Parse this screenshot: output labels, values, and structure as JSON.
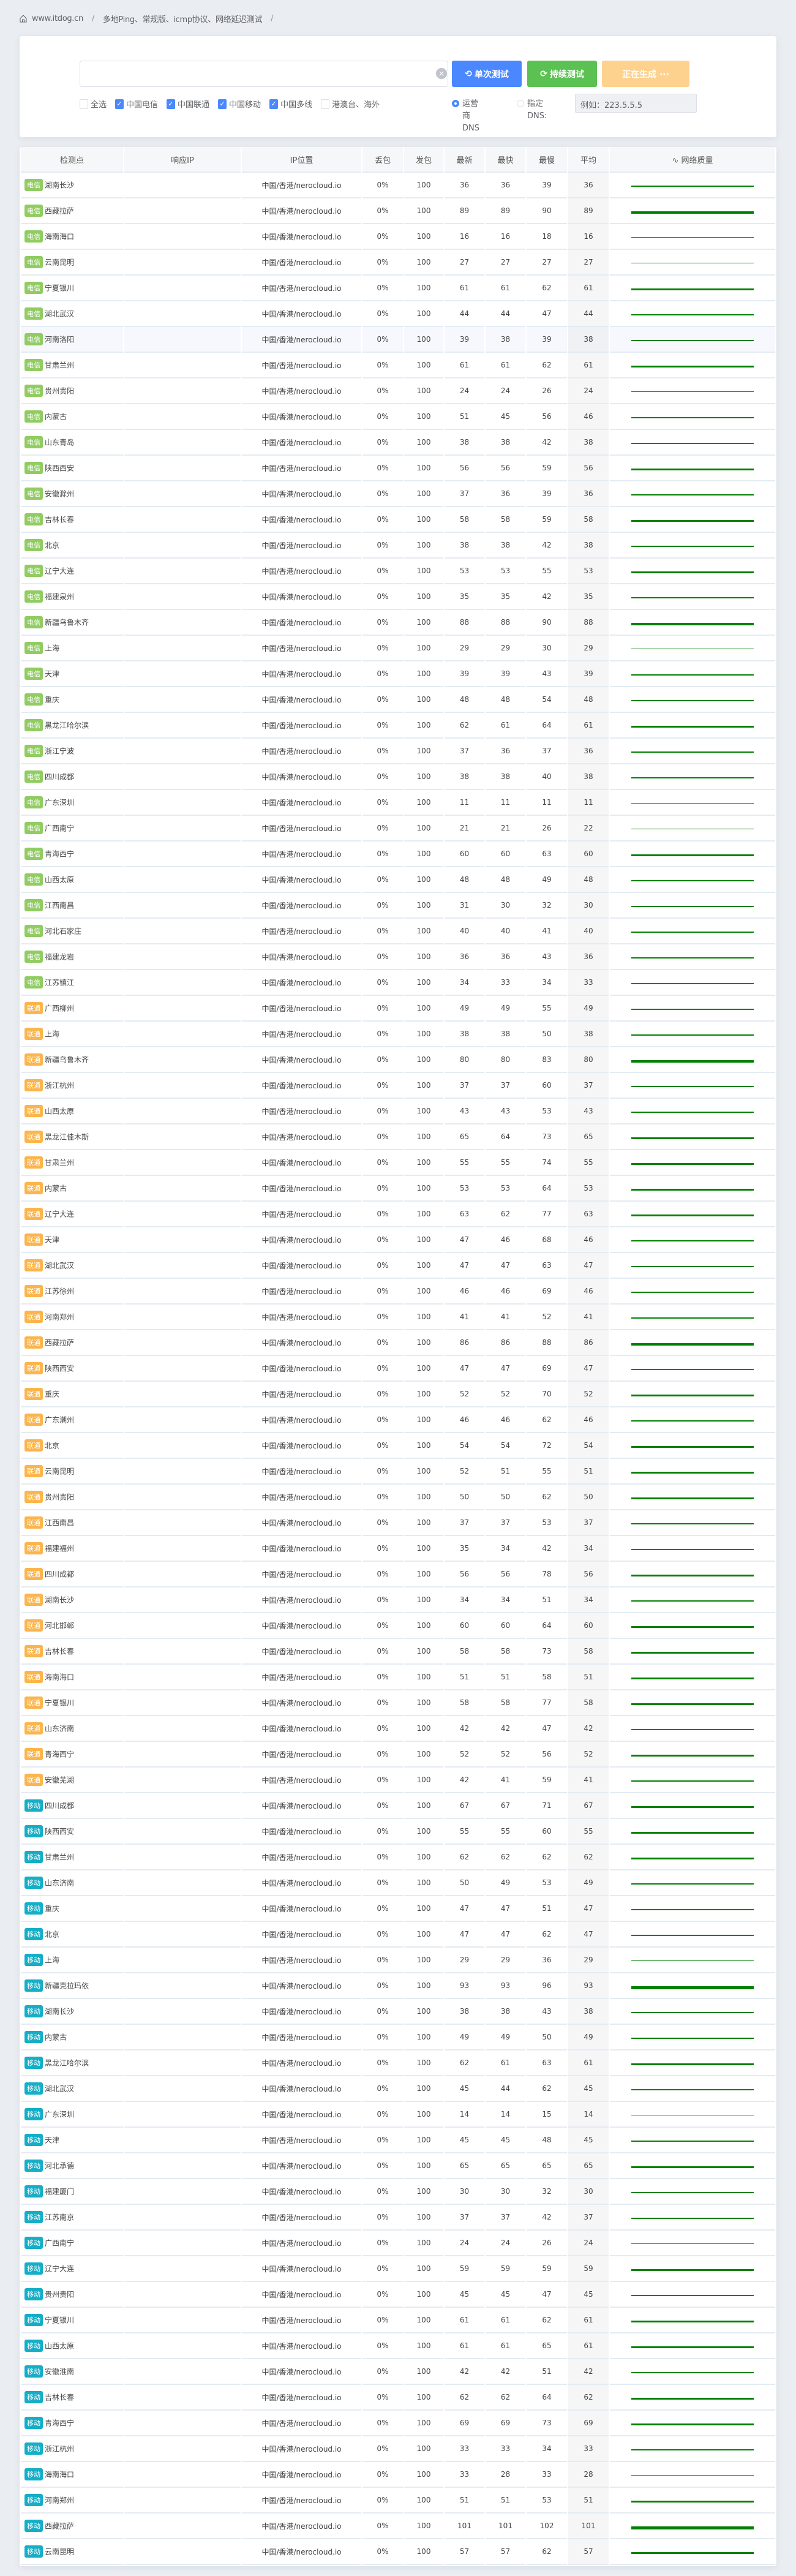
{
  "breadcrumb": {
    "site": "www.itdog.cn",
    "page": "多地Ping、常规版、icmp协议、网络延迟测试",
    "separator": "/"
  },
  "search": {
    "host_value": "",
    "single_test_label": "单次测试",
    "continuous_test_label": "持续测试",
    "generating_label": "正在生成 ···",
    "checkboxes": [
      {
        "label": "全选",
        "checked": false
      },
      {
        "label": "中国电信",
        "checked": true
      },
      {
        "label": "中国联通",
        "checked": true
      },
      {
        "label": "中国移动",
        "checked": true
      },
      {
        "label": "中国多线",
        "checked": true
      },
      {
        "label": "港澳台、海外",
        "checked": false
      }
    ],
    "dns_options": [
      {
        "label": "运营商DNS",
        "selected": true
      },
      {
        "label": "指定DNS:",
        "selected": false
      }
    ],
    "dns_placeholder": "例如：223.5.5.5"
  },
  "table": {
    "headers": [
      "检测点",
      "响应IP",
      "IP位置",
      "丢包",
      "发包",
      "最新",
      "最快",
      "最慢",
      "平均",
      "网络质量"
    ],
    "quality_icon": "pulse-icon",
    "isp_colors": {
      "电信": "#91cc63",
      "联通": "#fbb54c",
      "移动": "#14aec7"
    },
    "quality_color": "#008000",
    "ip_location": "中国/香港/nerocloud.io",
    "loss": "0%",
    "sent": "100",
    "rows": [
      [
        "电信",
        "湖南长沙",
        36,
        36,
        39,
        36
      ],
      [
        "电信",
        "西藏拉萨",
        89,
        89,
        90,
        89
      ],
      [
        "电信",
        "海南海口",
        16,
        16,
        18,
        16
      ],
      [
        "电信",
        "云南昆明",
        27,
        27,
        27,
        27
      ],
      [
        "电信",
        "宁夏银川",
        61,
        61,
        62,
        61
      ],
      [
        "电信",
        "湖北武汉",
        44,
        44,
        47,
        44
      ],
      [
        "电信",
        "河南洛阳",
        39,
        38,
        39,
        38
      ],
      [
        "电信",
        "甘肃兰州",
        61,
        61,
        62,
        61
      ],
      [
        "电信",
        "贵州贵阳",
        24,
        24,
        26,
        24
      ],
      [
        "电信",
        "内蒙古",
        51,
        45,
        56,
        46
      ],
      [
        "电信",
        "山东青岛",
        38,
        38,
        42,
        38
      ],
      [
        "电信",
        "陕西西安",
        56,
        56,
        59,
        56
      ],
      [
        "电信",
        "安徽滁州",
        37,
        36,
        39,
        36
      ],
      [
        "电信",
        "吉林长春",
        58,
        58,
        59,
        58
      ],
      [
        "电信",
        "北京",
        38,
        38,
        42,
        38
      ],
      [
        "电信",
        "辽宁大连",
        53,
        53,
        55,
        53
      ],
      [
        "电信",
        "福建泉州",
        35,
        35,
        42,
        35
      ],
      [
        "电信",
        "新疆乌鲁木齐",
        88,
        88,
        90,
        88
      ],
      [
        "电信",
        "上海",
        29,
        29,
        30,
        29
      ],
      [
        "电信",
        "天津",
        39,
        39,
        43,
        39
      ],
      [
        "电信",
        "重庆",
        48,
        48,
        54,
        48
      ],
      [
        "电信",
        "黑龙江哈尔滨",
        62,
        61,
        64,
        61
      ],
      [
        "电信",
        "浙江宁波",
        37,
        36,
        37,
        36
      ],
      [
        "电信",
        "四川成都",
        38,
        38,
        40,
        38
      ],
      [
        "电信",
        "广东深圳",
        11,
        11,
        11,
        11
      ],
      [
        "电信",
        "广西南宁",
        21,
        21,
        26,
        22
      ],
      [
        "电信",
        "青海西宁",
        60,
        60,
        63,
        60
      ],
      [
        "电信",
        "山西太原",
        48,
        48,
        49,
        48
      ],
      [
        "电信",
        "江西南昌",
        31,
        30,
        32,
        30
      ],
      [
        "电信",
        "河北石家庄",
        40,
        40,
        41,
        40
      ],
      [
        "电信",
        "福建龙岩",
        36,
        36,
        43,
        36
      ],
      [
        "电信",
        "江苏镇江",
        34,
        33,
        34,
        33
      ],
      [
        "联通",
        "广西柳州",
        49,
        49,
        55,
        49
      ],
      [
        "联通",
        "上海",
        38,
        38,
        50,
        38
      ],
      [
        "联通",
        "新疆乌鲁木齐",
        80,
        80,
        83,
        80
      ],
      [
        "联通",
        "浙江杭州",
        37,
        37,
        60,
        37
      ],
      [
        "联通",
        "山西太原",
        43,
        43,
        53,
        43
      ],
      [
        "联通",
        "黑龙江佳木斯",
        65,
        64,
        73,
        65
      ],
      [
        "联通",
        "甘肃兰州",
        55,
        55,
        74,
        55
      ],
      [
        "联通",
        "内蒙古",
        53,
        53,
        64,
        53
      ],
      [
        "联通",
        "辽宁大连",
        63,
        62,
        77,
        63
      ],
      [
        "联通",
        "天津",
        47,
        46,
        68,
        46
      ],
      [
        "联通",
        "湖北武汉",
        47,
        47,
        63,
        47
      ],
      [
        "联通",
        "江苏徐州",
        46,
        46,
        69,
        46
      ],
      [
        "联通",
        "河南郑州",
        41,
        41,
        52,
        41
      ],
      [
        "联通",
        "西藏拉萨",
        86,
        86,
        88,
        86
      ],
      [
        "联通",
        "陕西西安",
        47,
        47,
        69,
        47
      ],
      [
        "联通",
        "重庆",
        52,
        52,
        70,
        52
      ],
      [
        "联通",
        "广东潮州",
        46,
        46,
        62,
        46
      ],
      [
        "联通",
        "北京",
        54,
        54,
        72,
        54
      ],
      [
        "联通",
        "云南昆明",
        52,
        51,
        55,
        51
      ],
      [
        "联通",
        "贵州贵阳",
        50,
        50,
        62,
        50
      ],
      [
        "联通",
        "江西南昌",
        37,
        37,
        53,
        37
      ],
      [
        "联通",
        "福建福州",
        35,
        34,
        42,
        34
      ],
      [
        "联通",
        "四川成都",
        56,
        56,
        78,
        56
      ],
      [
        "联通",
        "湖南长沙",
        34,
        34,
        51,
        34
      ],
      [
        "联通",
        "河北邯郸",
        60,
        60,
        64,
        60
      ],
      [
        "联通",
        "吉林长春",
        58,
        58,
        73,
        58
      ],
      [
        "联通",
        "海南海口",
        51,
        51,
        58,
        51
      ],
      [
        "联通",
        "宁夏银川",
        58,
        58,
        77,
        58
      ],
      [
        "联通",
        "山东济南",
        42,
        42,
        47,
        42
      ],
      [
        "联通",
        "青海西宁",
        52,
        52,
        56,
        52
      ],
      [
        "联通",
        "安徽芜湖",
        42,
        41,
        59,
        41
      ],
      [
        "移动",
        "四川成都",
        67,
        67,
        71,
        67
      ],
      [
        "移动",
        "陕西西安",
        55,
        55,
        60,
        55
      ],
      [
        "移动",
        "甘肃兰州",
        62,
        62,
        62,
        62
      ],
      [
        "移动",
        "山东济南",
        50,
        49,
        53,
        49
      ],
      [
        "移动",
        "重庆",
        47,
        47,
        51,
        47
      ],
      [
        "移动",
        "北京",
        47,
        47,
        62,
        47
      ],
      [
        "移动",
        "上海",
        29,
        29,
        36,
        29
      ],
      [
        "移动",
        "新疆克拉玛依",
        93,
        93,
        96,
        93
      ],
      [
        "移动",
        "湖南长沙",
        38,
        38,
        43,
        38
      ],
      [
        "移动",
        "内蒙古",
        49,
        49,
        50,
        49
      ],
      [
        "移动",
        "黑龙江哈尔滨",
        62,
        61,
        63,
        61
      ],
      [
        "移动",
        "湖北武汉",
        45,
        44,
        62,
        45
      ],
      [
        "移动",
        "广东深圳",
        14,
        14,
        15,
        14
      ],
      [
        "移动",
        "天津",
        45,
        45,
        48,
        45
      ],
      [
        "移动",
        "河北承德",
        65,
        65,
        65,
        65
      ],
      [
        "移动",
        "福建厦门",
        30,
        30,
        32,
        30
      ],
      [
        "移动",
        "江苏南京",
        37,
        37,
        42,
        37
      ],
      [
        "移动",
        "广西南宁",
        24,
        24,
        26,
        24
      ],
      [
        "移动",
        "辽宁大连",
        59,
        59,
        59,
        59
      ],
      [
        "移动",
        "贵州贵阳",
        45,
        45,
        47,
        45
      ],
      [
        "移动",
        "宁夏银川",
        61,
        61,
        62,
        61
      ],
      [
        "移动",
        "山西太原",
        61,
        61,
        65,
        61
      ],
      [
        "移动",
        "安徽淮南",
        42,
        42,
        51,
        42
      ],
      [
        "移动",
        "吉林长春",
        62,
        62,
        64,
        62
      ],
      [
        "移动",
        "青海西宁",
        69,
        69,
        73,
        69
      ],
      [
        "移动",
        "浙江杭州",
        33,
        33,
        34,
        33
      ],
      [
        "移动",
        "海南海口",
        33,
        28,
        33,
        28
      ],
      [
        "移动",
        "河南郑州",
        51,
        51,
        53,
        51
      ],
      [
        "移动",
        "西藏拉萨",
        101,
        101,
        102,
        101
      ],
      [
        "移动",
        "云南昆明",
        57,
        57,
        62,
        57
      ]
    ]
  }
}
